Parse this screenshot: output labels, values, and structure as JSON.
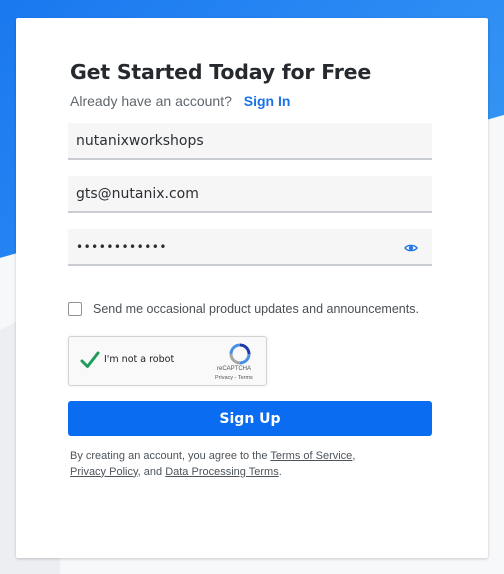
{
  "form": {
    "title": "Get Started Today for Free",
    "have_account": "Already have an account?",
    "sign_in_link": "Sign In",
    "username_value": "nutanixworkshops",
    "email_value": "gts@nutanix.com",
    "password_mask": "••••••••••••",
    "password_toggle_icon": "eye-icon",
    "updates_checkbox_label": "Send me occasional product updates and announcements.",
    "updates_checkbox_checked": false,
    "signup_button": "Sign Up"
  },
  "recaptcha": {
    "label": "I'm not a robot",
    "brand": "reCAPTCHA",
    "links": "Privacy - Terms",
    "checked": true
  },
  "legal": {
    "prefix": "By creating an account, you agree to the",
    "terms_link": "Terms of Service",
    "sep1": ",",
    "privacy_link": "Privacy Policy",
    "sep2": ", and",
    "dpt_link": "Data Processing Terms",
    "suffix": "."
  },
  "colors": {
    "accent": "#0a6cf0",
    "link": "#1a73e8",
    "background_blue": "#1a78f0",
    "recaptcha_check": "#1e9e5a"
  }
}
